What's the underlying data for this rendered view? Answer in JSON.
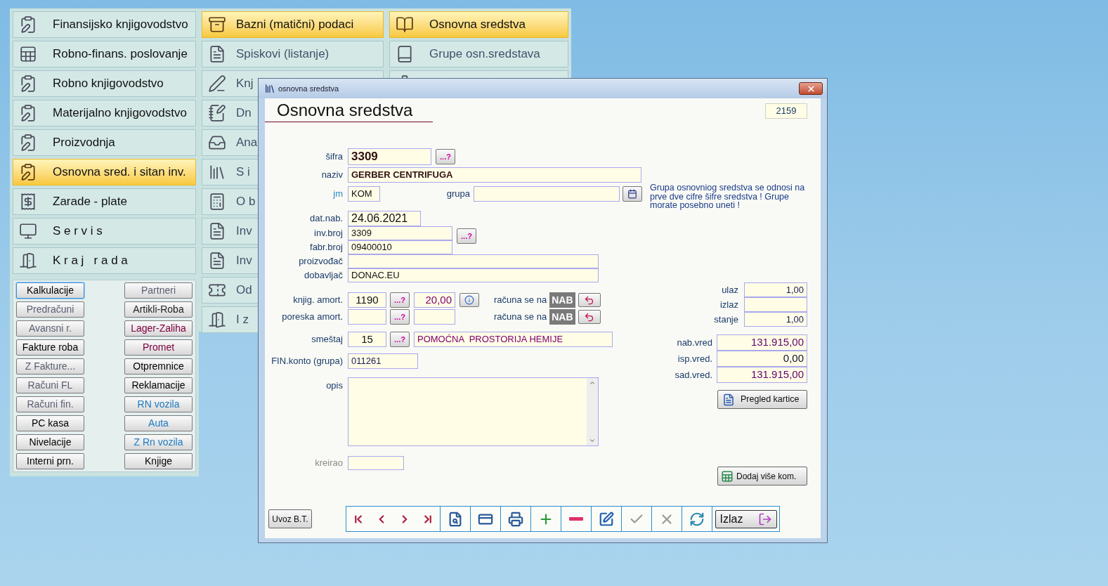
{
  "menu_columns": [
    [
      {
        "label": "Finansijsko knjigovodstvo",
        "selected": false
      },
      {
        "label": "Robno-finans. poslovanje",
        "selected": false
      },
      {
        "label": "Robno knjigovodstvo",
        "selected": false
      },
      {
        "label": "Materijalno knjigovodstvo",
        "selected": false
      },
      {
        "label": "Proizvodnja",
        "selected": false
      },
      {
        "label": "Osnovna sred. i sitan inv.",
        "selected": true
      },
      {
        "label": "Zarade - plate",
        "selected": false
      },
      {
        "label": "S e r v i s",
        "selected": false
      },
      {
        "label": "K r a j   r a d a",
        "selected": false
      }
    ],
    [
      {
        "label": "Bazni (matični) podaci",
        "selected": true
      },
      {
        "label": "Spiskovi (listanje)",
        "selected": false
      },
      {
        "label": "Knj",
        "selected": false
      },
      {
        "label": "Dn",
        "selected": false
      },
      {
        "label": "Ana",
        "selected": false
      },
      {
        "label": "S i",
        "selected": false
      },
      {
        "label": "O b",
        "selected": false
      },
      {
        "label": "Inv",
        "selected": false
      },
      {
        "label": "Inv",
        "selected": false
      },
      {
        "label": "Od",
        "selected": false
      },
      {
        "label": "I z",
        "selected": false
      }
    ],
    [
      {
        "label": "Osnovna sredstva",
        "selected": true
      },
      {
        "label": "Grupe osn.sredstava",
        "selected": false
      },
      {
        "selected": false
      }
    ]
  ],
  "shortcut_buttons": [
    [
      {
        "label": "Kalkulacije",
        "color": "#000000",
        "selected": true
      },
      {
        "label": "Predračuni",
        "color": "#5a5e72",
        "selected": false
      },
      {
        "label": "Avansni r.",
        "color": "#5a5e72",
        "selected": false
      },
      {
        "label": "Fakture roba",
        "color": "#000000",
        "selected": false
      },
      {
        "label": "Z Fakture...",
        "color": "#5a5e72",
        "selected": false
      },
      {
        "label": "Računi FL",
        "color": "#5a5e72",
        "selected": false
      },
      {
        "label": "Računi fin.",
        "color": "#5a5e72",
        "selected": false
      },
      {
        "label": "PC kasa",
        "color": "#000000",
        "selected": false
      },
      {
        "label": "Nivelacije",
        "color": "#000000",
        "selected": false
      },
      {
        "label": "Interni prn.",
        "color": "#000000",
        "selected": false
      }
    ],
    [
      {
        "label": "Partneri",
        "color": "#5a5e72",
        "selected": false
      },
      {
        "label": "Artikli-Roba",
        "color": "#222222",
        "selected": false
      },
      {
        "label": "Lager-Zaliha",
        "color": "#800040",
        "selected": false
      },
      {
        "label": "Promet",
        "color": "#800040",
        "selected": false
      },
      {
        "label": "Otpremnice",
        "color": "#000000",
        "selected": false
      },
      {
        "label": "Reklamacije",
        "color": "#000000",
        "selected": false
      },
      {
        "label": "RN vozila",
        "color": "#1e7ac0",
        "selected": false
      },
      {
        "label": "Auta",
        "color": "#1e7ac0",
        "selected": false
      },
      {
        "label": "Z Rn vozila",
        "color": "#1e7ac0",
        "selected": false
      },
      {
        "label": "Knjige",
        "color": "#000000",
        "selected": false
      }
    ]
  ],
  "dialog": {
    "title": "osnovna sredstva",
    "heading": "Osnovna sredstva",
    "record_number": "2159",
    "sifra": {
      "label": "šifra",
      "value": "3309",
      "lookup": "...?"
    },
    "naziv": {
      "label": "naziv",
      "value": "GERBER CENTRIFUGA"
    },
    "jm": {
      "label": "jm",
      "value": "KOM"
    },
    "grupa": {
      "label": "grupa",
      "note": "Grupa osnovniog sredstva se odnosi na prve dve cifre šifre sredstva ! Grupe morate posebno uneti !"
    },
    "dat_nab": {
      "label": "dat.nab.",
      "value": "24.06.2021"
    },
    "inv_broj": {
      "label": "inv.broj",
      "value": "3309",
      "lookup": "...?"
    },
    "fabr_broj": {
      "label": "fabr.broj",
      "value": "09400010"
    },
    "proizvodjac": {
      "label": "proizvođač"
    },
    "dobavljac": {
      "label": "dobavljač",
      "value": "DONAC.EU"
    },
    "amortization": [
      {
        "label": "knjig. amort.",
        "code": "1190",
        "lookup": "...?",
        "rate": "20,00",
        "basis_label": "računa se na",
        "basis": "NAB"
      },
      {
        "label": "poreska amort.",
        "lookup": "...?",
        "basis_label": "računa se na",
        "basis": "NAB"
      }
    ],
    "smestaj": {
      "label": "smeštaj",
      "code": "15",
      "lookup": "...?",
      "value": "POMOĆNA  PROSTORIJA HEMIJE"
    },
    "fin_konto": {
      "label": "FIN.konto (grupa)",
      "value": "011261"
    },
    "opis": {
      "label": "opis"
    },
    "kreirao": {
      "label": "kreirao"
    },
    "quantities": [
      {
        "label": "ulaz",
        "value": "1,00"
      },
      {
        "label": "izlaz"
      },
      {
        "label": "stanje",
        "value": "1,00"
      }
    ],
    "values": [
      {
        "label": "nab.vred",
        "value": "131.915,00"
      },
      {
        "label": "isp.vred.",
        "value": "0,00"
      },
      {
        "label": "sad.vred.",
        "value": "131.915,00"
      }
    ],
    "card_button": "Pregled kartice",
    "add_button": "Dodaj više kom.",
    "import_button": "Uvoz B.T.",
    "exit_button": "Izlaz"
  }
}
